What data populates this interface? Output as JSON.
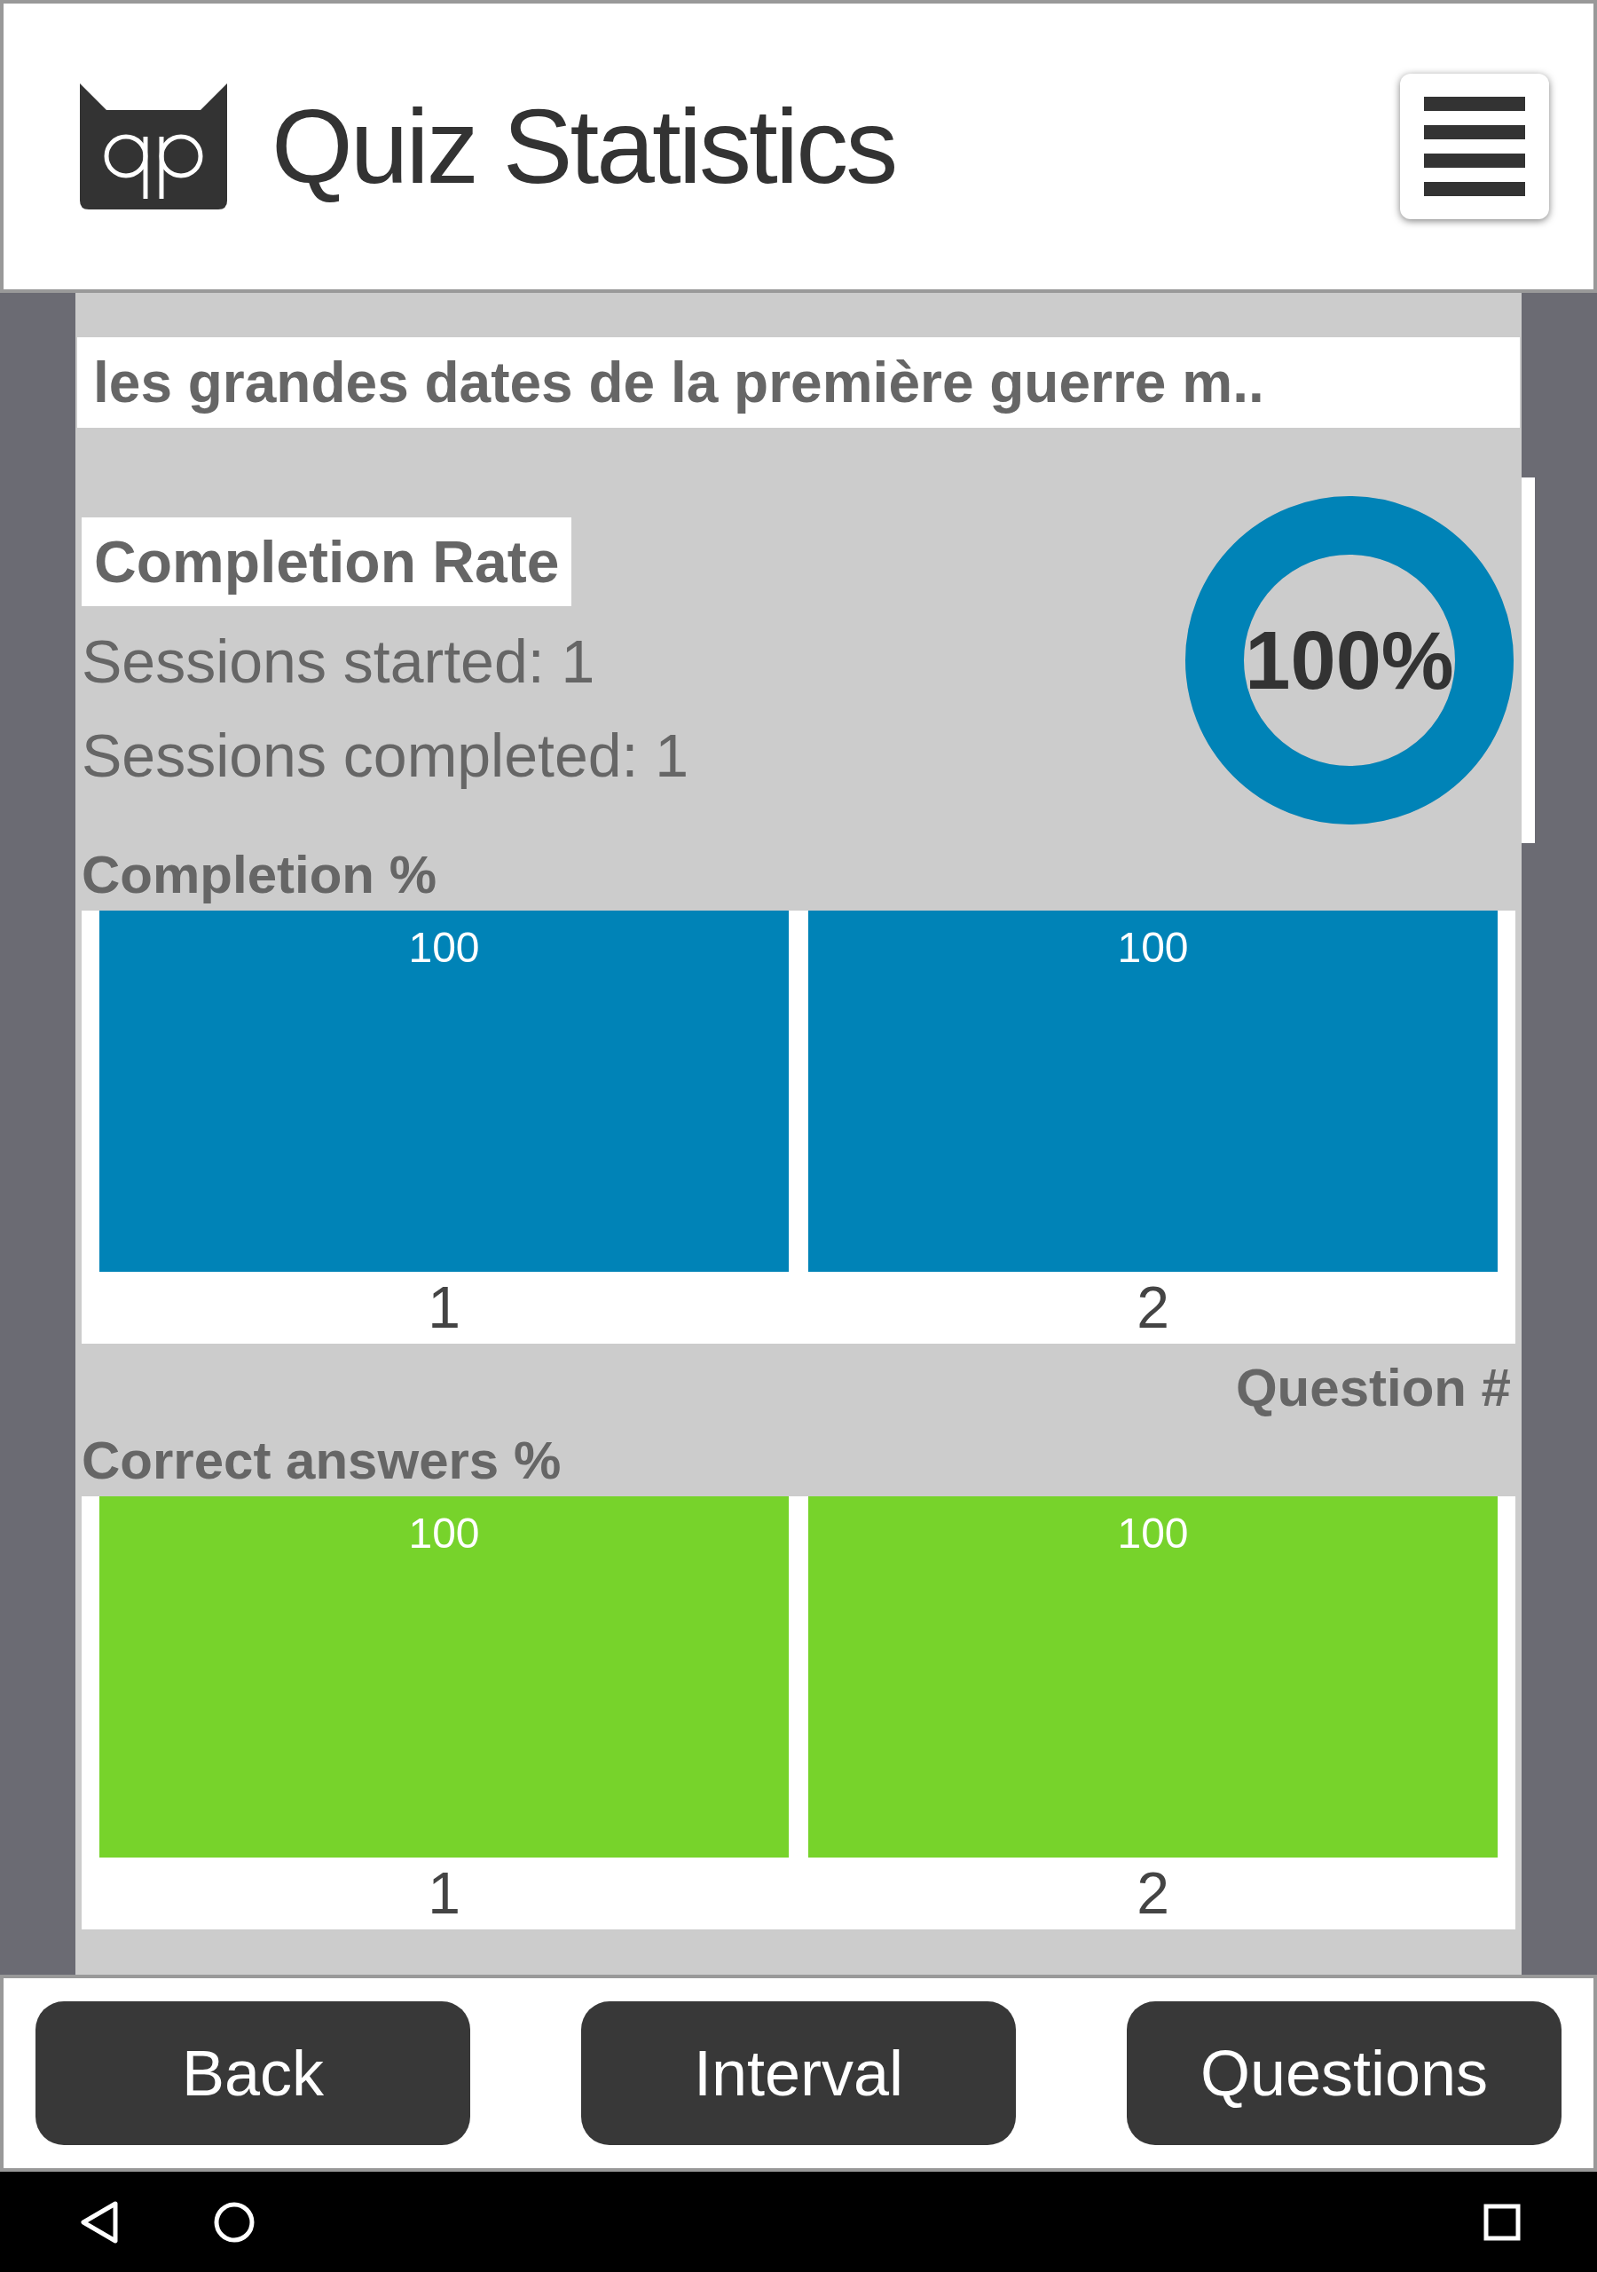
{
  "header": {
    "title": "Quiz Statistics"
  },
  "quiz_title": "les grandes dates de la première guerre m..",
  "completion_rate": {
    "label": "Completion Rate",
    "sessions_started": "Sessions started: 1",
    "sessions_completed": "Sessions completed: 1",
    "percent": "100%",
    "level": 1.0
  },
  "charts": [
    {
      "chart_data": {
        "type": "bar",
        "title": "Completion %",
        "xlabel": "Question #",
        "categories": [
          "1",
          "2"
        ],
        "data_labels": true,
        "series": [
          {
            "color": "#0083b7",
            "values": [
              100,
              100
            ]
          }
        ]
      }
    },
    {
      "chart_data": {
        "type": "bar",
        "title": "Correct answers %",
        "categories": [
          "1",
          "2"
        ],
        "data_labels": true,
        "series": [
          {
            "color": "#77d32b",
            "values": [
              100,
              100
            ]
          }
        ]
      }
    }
  ],
  "buttons": [
    "Back",
    "Interval",
    "Questions"
  ]
}
